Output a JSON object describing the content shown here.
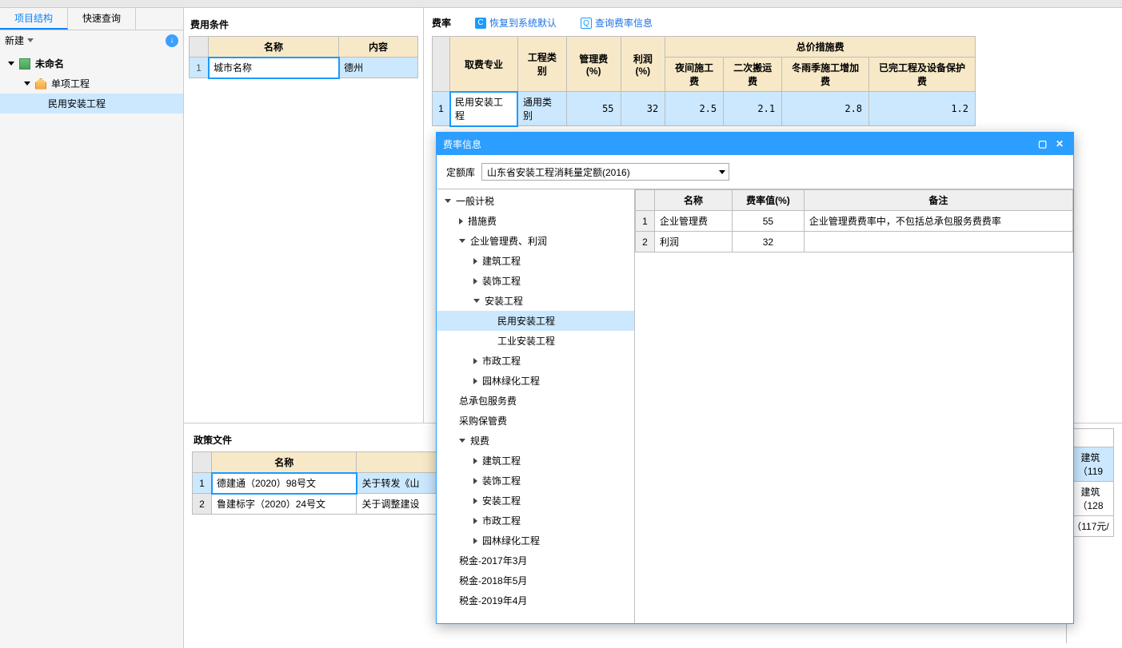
{
  "left": {
    "tabs": {
      "a": "项目结构",
      "b": "快速查询"
    },
    "new_btn": "新建",
    "tree": {
      "root": "未命名",
      "sub": "单项工程",
      "leaf": "民用安装工程"
    }
  },
  "cond": {
    "title": "费用条件",
    "headers": {
      "name": "名称",
      "content": "内容"
    },
    "row": {
      "no": "1",
      "name": "城市名称",
      "content": "德州"
    }
  },
  "rate": {
    "title": "费率",
    "btn_reset": "恢复到系统默认",
    "btn_query": "查询费率信息",
    "head": {
      "corner": "",
      "major": "取费专业",
      "type": "工程类别",
      "mgmt": "管理费(%)",
      "profit": "利润(%)",
      "group": "总价措施费",
      "c1": "夜间施工费",
      "c2": "二次搬运费",
      "c3": "冬雨季施工增加费",
      "c4": "已完工程及设备保护费"
    },
    "row": {
      "no": "1",
      "major": "民用安装工程",
      "type": "通用类别",
      "mgmt": "55",
      "profit": "32",
      "c1": "2.5",
      "c2": "2.1",
      "c3": "2.8",
      "c4": "1.2"
    }
  },
  "policy": {
    "title": "政策文件",
    "headers": {
      "name": "名称"
    },
    "rows": [
      {
        "no": "1",
        "name": "德建通（2020）98号文",
        "desc": "关于转发《山"
      },
      {
        "no": "2",
        "name": "鲁建标字（2020）24号文",
        "desc": "关于调整建设"
      }
    ],
    "far": {
      "a": "建筑（119",
      "b": "建筑（128",
      "c": "（117元/"
    }
  },
  "modal": {
    "title": "费率信息",
    "filter_label": "定额库",
    "combo_value": "山东省安装工程消耗量定额(2016)",
    "tree": {
      "t0": "一般计税",
      "t0a": "措施费",
      "t0b": "企业管理费、利润",
      "t0b1": "建筑工程",
      "t0b2": "装饰工程",
      "t0b3": "安装工程",
      "t0b3a": "民用安装工程",
      "t0b3b": "工业安装工程",
      "t0b4": "市政工程",
      "t0b5": "园林绿化工程",
      "t0c": "总承包服务费",
      "t0d": "采购保管费",
      "t0e": "规费",
      "t0e1": "建筑工程",
      "t0e2": "装饰工程",
      "t0e3": "安装工程",
      "t0e4": "市政工程",
      "t0e5": "园林绿化工程",
      "t0f": "税金-2017年3月",
      "t0g": "税金-2018年5月",
      "t0h": "税金-2019年4月"
    },
    "mhead": {
      "name": "名称",
      "val": "费率值(%)",
      "note": "备注"
    },
    "mrows": [
      {
        "no": "1",
        "name": "企业管理费",
        "val": "55",
        "note": "企业管理费费率中，不包括总承包服务费费率"
      },
      {
        "no": "2",
        "name": "利润",
        "val": "32",
        "note": ""
      }
    ]
  }
}
